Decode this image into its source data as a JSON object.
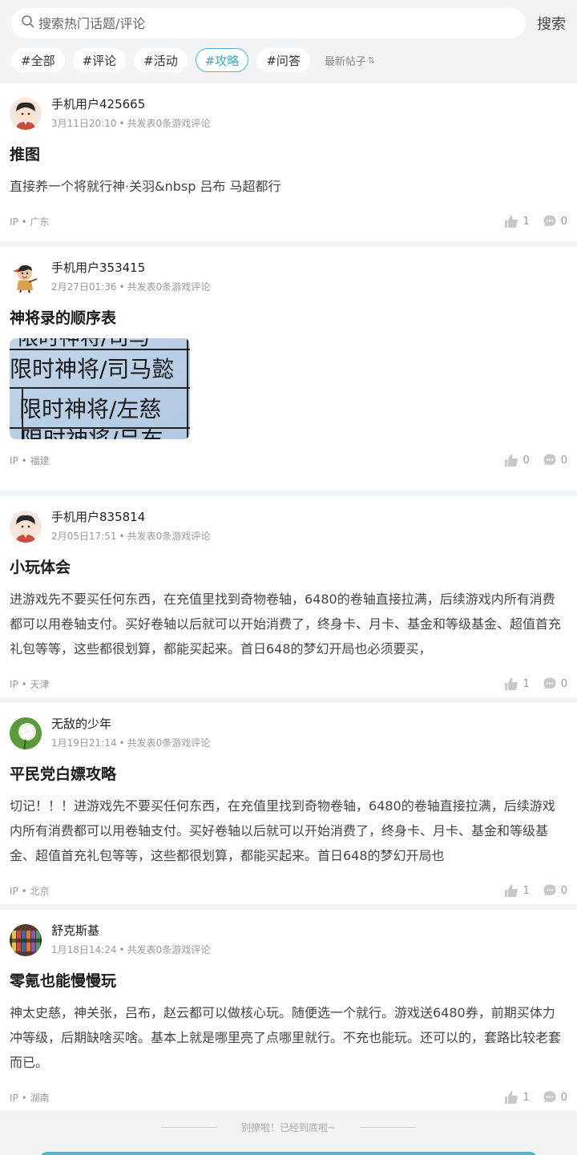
{
  "search": {
    "placeholder": "搜索热门话题/评论",
    "button_label": "搜索"
  },
  "tags": [
    {
      "label": "#全部",
      "active": false
    },
    {
      "label": "#评论",
      "active": false
    },
    {
      "label": "#活动",
      "active": false
    },
    {
      "label": "#攻略",
      "active": true
    },
    {
      "label": "#问答",
      "active": false
    }
  ],
  "sort": {
    "label": "最新帖子",
    "icon": "sort-arrows-icon"
  },
  "posts": [
    {
      "author": "手机用户425665",
      "date": "3月11日20:10",
      "meta": "共发表0条游戏评论",
      "title": "推图",
      "content": "直接养一个将就行神·关羽&nbsp 吕布 马超都行",
      "ip": "IP",
      "location": "广东",
      "likes": "1",
      "comments": "0"
    },
    {
      "author": "手机用户353415",
      "date": "2月27日01:36",
      "meta": "共发表0条游戏评论",
      "title": "神将录的顺序表",
      "image_lines": [
        "限时神将/司马懿",
        "限时神将/左慈"
      ],
      "ip": "IP",
      "location": "福建",
      "likes": "0",
      "comments": "0"
    },
    {
      "author": "手机用户835814",
      "date": "2月05日17:51",
      "meta": "共发表0条游戏评论",
      "title": "小玩体会",
      "content": "进游戏先不要买任何东西，在充值里找到奇物卷轴，6480的卷轴直接拉满，后续游戏内所有消费都可以用卷轴支付。买好卷轴以后就可以开始消费了，终身卡、月卡、基金和等级基金、超值首充礼包等等，这些都很划算，都能买起来。首日648的梦幻开局也必须要买，",
      "ip": "IP",
      "location": "天津",
      "likes": "1",
      "comments": "0"
    },
    {
      "author": "无敌的少年",
      "date": "1月19日21:14",
      "meta": "共发表0条游戏评论",
      "title": "平民党白嫖攻略",
      "content": "切记！！！进游戏先不要买任何东西，在充值里找到奇物卷轴，6480的卷轴直接拉满，后续游戏内所有消费都可以用卷轴支付。买好卷轴以后就可以开始消费了，终身卡、月卡、基金和等级基金、超值首充礼包等等，这些都很划算，都能买起来。首日648的梦幻开局也",
      "ip": "IP",
      "location": "北京",
      "likes": "1",
      "comments": "0"
    },
    {
      "author": "舒克斯基",
      "date": "1月18日14:24",
      "meta": "共发表0条游戏评论",
      "title": "零氪也能慢慢玩",
      "content": "神太史慈，神关张，吕布，赵云都可以做核心玩。随便选一个就行。游戏送6480券，前期买体力冲等级，后期缺啥买啥。基本上就是哪里亮了点哪里就行。不充也能玩。还可以的，套路比较老套而已。",
      "ip": "IP",
      "location": "湖南",
      "likes": "1",
      "comments": "0"
    }
  ],
  "end_text": "别撩啦！已经到底啦~",
  "colors": {
    "accent": "#4cb8c8",
    "background": "#f2f3f5"
  }
}
